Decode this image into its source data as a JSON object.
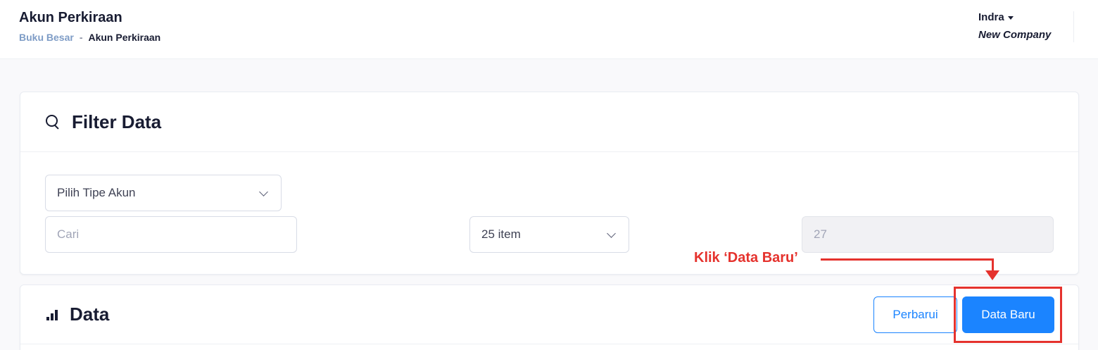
{
  "header": {
    "page_title": "Akun Perkiraan",
    "breadcrumb": {
      "parent": "Buku Besar",
      "separator": "-",
      "current": "Akun Perkiraan"
    },
    "user": {
      "name": "Indra",
      "company": "New Company"
    }
  },
  "filter": {
    "title": "Filter Data",
    "account_type_select": "Pilih Tipe Akun",
    "search_placeholder": "Cari",
    "page_size": "25 item",
    "total_count": "27"
  },
  "data_section": {
    "title": "Data",
    "refresh_label": "Perbarui",
    "new_label": "Data Baru"
  },
  "annotation": {
    "text": "Klik ‘Data Baru’",
    "color": "#e5322d"
  },
  "colors": {
    "primary": "#1b84ff",
    "breadcrumb_link": "#7e9cc6"
  }
}
